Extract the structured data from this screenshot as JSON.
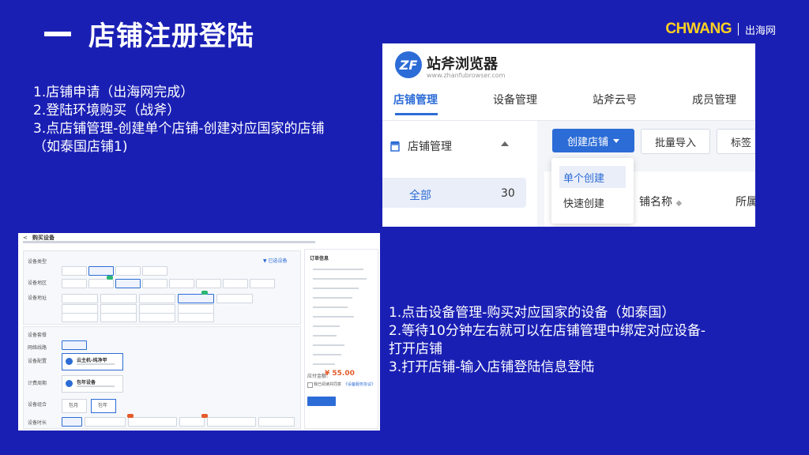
{
  "slide": {
    "title": "店铺注册登陆",
    "brand": {
      "name": "CHWANG",
      "sub": "出海网"
    }
  },
  "steps_top": [
    "1.店铺申请（出海网完成）",
    "2.登陆环境购买（战斧）",
    "3.点店铺管理-创建单个店铺-创建对应国家的店铺",
    "（如泰国店铺1)"
  ],
  "steps_bottom": [
    "1.点击设备管理-购买对应国家的设备（如泰国）",
    "2.等待10分钟左右就可以在店铺管理中绑定对应设备-",
    "打开店铺",
    "3.打开店铺-输入店铺登陆信息登陆"
  ],
  "browser": {
    "logo_text": "站斧浏览器",
    "logo_url": "www.zhanfubrowser.com",
    "nav": [
      "店铺管理",
      "设备管理",
      "站斧云号",
      "成员管理"
    ],
    "sidebar_title": "店铺管理",
    "sidebar_all": "全部",
    "sidebar_count": "30",
    "create_button": "创建店铺",
    "import_button": "批量导入",
    "tag_button": "标签",
    "dropdown": [
      "单个创建",
      "快速创建"
    ],
    "col_name": "铺名称",
    "col_group": "所属"
  },
  "purchase": {
    "back": "<",
    "title": "购买设备",
    "region_filter": "▼ 已选设备",
    "labels": [
      "设备类型",
      "设备地区",
      "设备地址",
      "设备套餐",
      "网络线路",
      "设备配置",
      "计费周期",
      "设备组合",
      "设备时长"
    ],
    "plan_names": [
      "云主机-纯净甲",
      "包年设备"
    ],
    "period_options": [
      "包月",
      "包年"
    ],
    "price_label": "应付金额：",
    "price": "¥ 55.00",
    "summary_title": "订单信息",
    "agree": "我已阅读并同意",
    "agree_link": "《设备服务协议》"
  }
}
